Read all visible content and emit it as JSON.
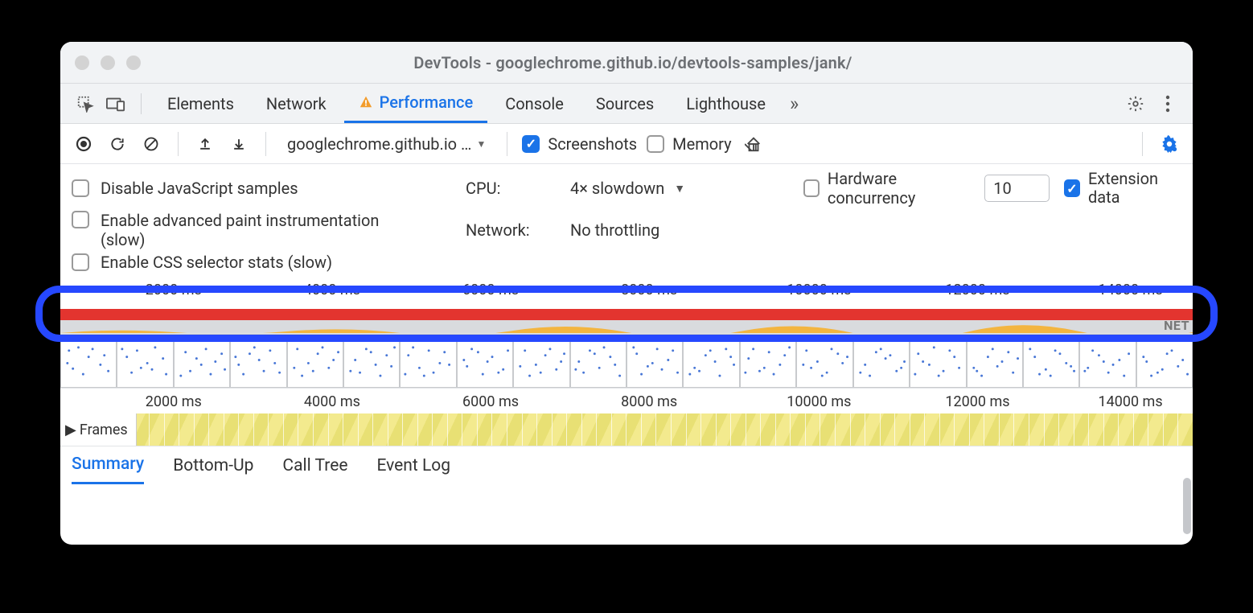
{
  "window": {
    "title": "DevTools - googlechrome.github.io/devtools-samples/jank/"
  },
  "tabs": {
    "items": [
      "Elements",
      "Network",
      "Performance",
      "Console",
      "Sources",
      "Lighthouse"
    ],
    "active": "Performance"
  },
  "toolbar": {
    "url_selector": "googlechrome.github.io …",
    "screenshots_label": "Screenshots",
    "screenshots_checked": true,
    "memory_label": "Memory",
    "memory_checked": false
  },
  "settings": {
    "disable_js_label": "Disable JavaScript samples",
    "disable_js_checked": false,
    "enable_paint_label": "Enable advanced paint instrumentation (slow)",
    "enable_paint_checked": false,
    "enable_css_label": "Enable CSS selector stats (slow)",
    "enable_css_checked": false,
    "cpu_label": "CPU:",
    "cpu_value": "4× slowdown",
    "network_label": "Network:",
    "network_value": "No throttling",
    "hw_concurrency_label": "Hardware concurrency",
    "hw_concurrency_checked": false,
    "hw_concurrency_value": "10",
    "extension_data_label": "Extension data",
    "extension_data_checked": true
  },
  "timeline": {
    "ticks": [
      "2000 ms",
      "4000 ms",
      "6000 ms",
      "8000 ms",
      "10000 ms",
      "12000 ms",
      "14000 ms"
    ],
    "net_label": "NET",
    "frames_label": "Frames"
  },
  "bottom_tabs": {
    "items": [
      "Summary",
      "Bottom-Up",
      "Call Tree",
      "Event Log"
    ],
    "active": "Summary"
  },
  "icons": {
    "inspect": "inspect",
    "device": "device",
    "gear": "gear",
    "more": "more",
    "record": "record",
    "reload": "reload",
    "clear": "clear",
    "upload": "upload",
    "download": "download",
    "trash": "trash",
    "gear_blue": "gear-blue",
    "warning": "warning",
    "chevrons": "»"
  }
}
